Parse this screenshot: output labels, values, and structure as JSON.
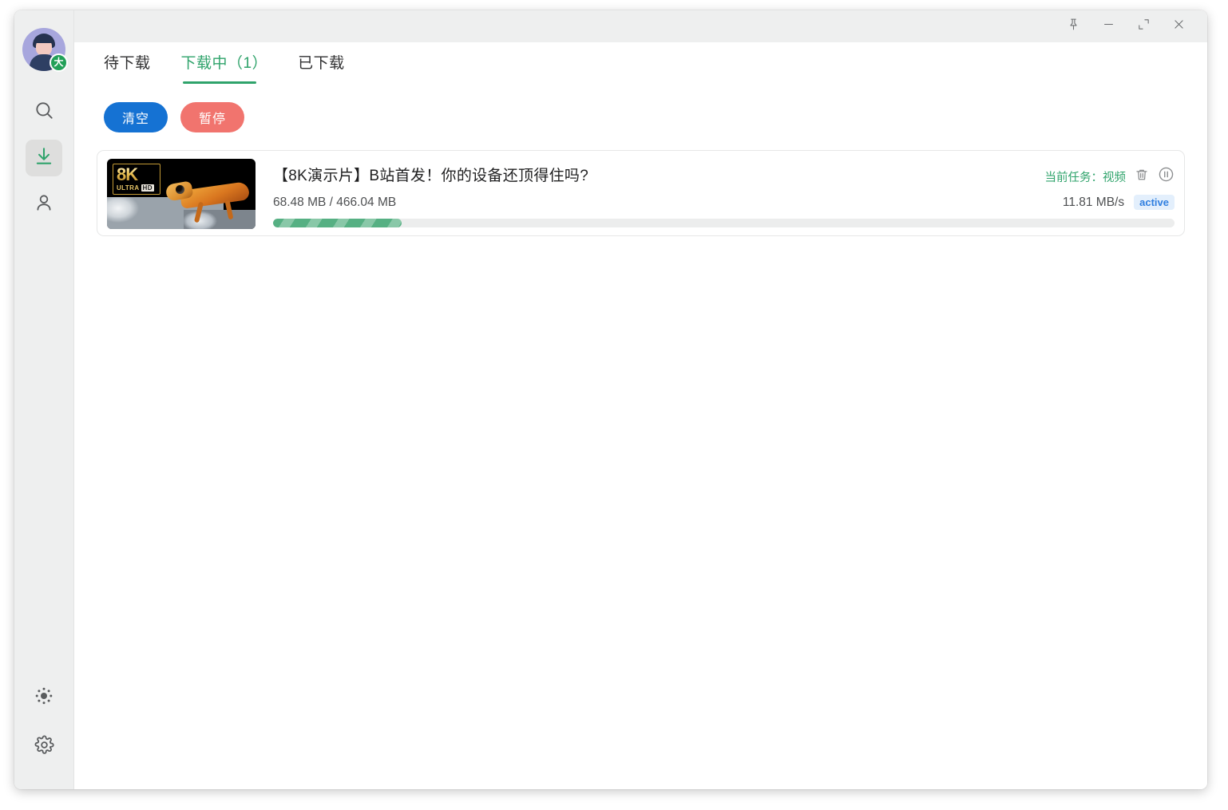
{
  "window": {
    "controls": [
      {
        "name": "pin-button",
        "icon": "pin-icon",
        "label": "钉住"
      },
      {
        "name": "minimize-button",
        "icon": "minimize-icon",
        "label": "最小化"
      },
      {
        "name": "maximize-button",
        "icon": "maximize-icon",
        "label": "最大化"
      },
      {
        "name": "close-button",
        "icon": "close-icon",
        "label": "关闭"
      }
    ]
  },
  "sidebar": {
    "avatar": {
      "badge_text": "大"
    },
    "items": [
      {
        "name": "search",
        "icon": "search-icon",
        "active": false
      },
      {
        "name": "download",
        "icon": "download-icon",
        "active": true
      },
      {
        "name": "account",
        "icon": "user-icon",
        "active": false
      }
    ],
    "bottom_items": [
      {
        "name": "theme",
        "icon": "brightness-icon"
      },
      {
        "name": "settings",
        "icon": "gear-icon"
      }
    ]
  },
  "tabs": [
    {
      "label": "待下载",
      "active": false
    },
    {
      "label": "下载中（1）",
      "active": true
    },
    {
      "label": "已下载",
      "active": false
    }
  ],
  "toolbar": {
    "clear_label": "清空",
    "pause_label": "暂停",
    "clear_color": "#1572d3",
    "pause_color": "#f1746e"
  },
  "tasks": [
    {
      "title": "【8K演示片】B站首发！你的设备还顶得住吗?",
      "downloaded": "68.48 MB",
      "total": "466.04 MB",
      "size_text": "68.48 MB / 466.04 MB",
      "speed": "11.81 MB/s",
      "status": "active",
      "current_task_label": "当前任务：视频",
      "progress_percent": 14.3,
      "thumbnail": {
        "badge_big": "8K",
        "badge_small": "ULTRA",
        "badge_small_hd": "HD"
      }
    }
  ],
  "colors": {
    "accent_green": "#2fa36b",
    "progress_green": "#56b083",
    "badge_blue_text": "#2f7fe0",
    "badge_blue_bg": "#e3effc"
  }
}
